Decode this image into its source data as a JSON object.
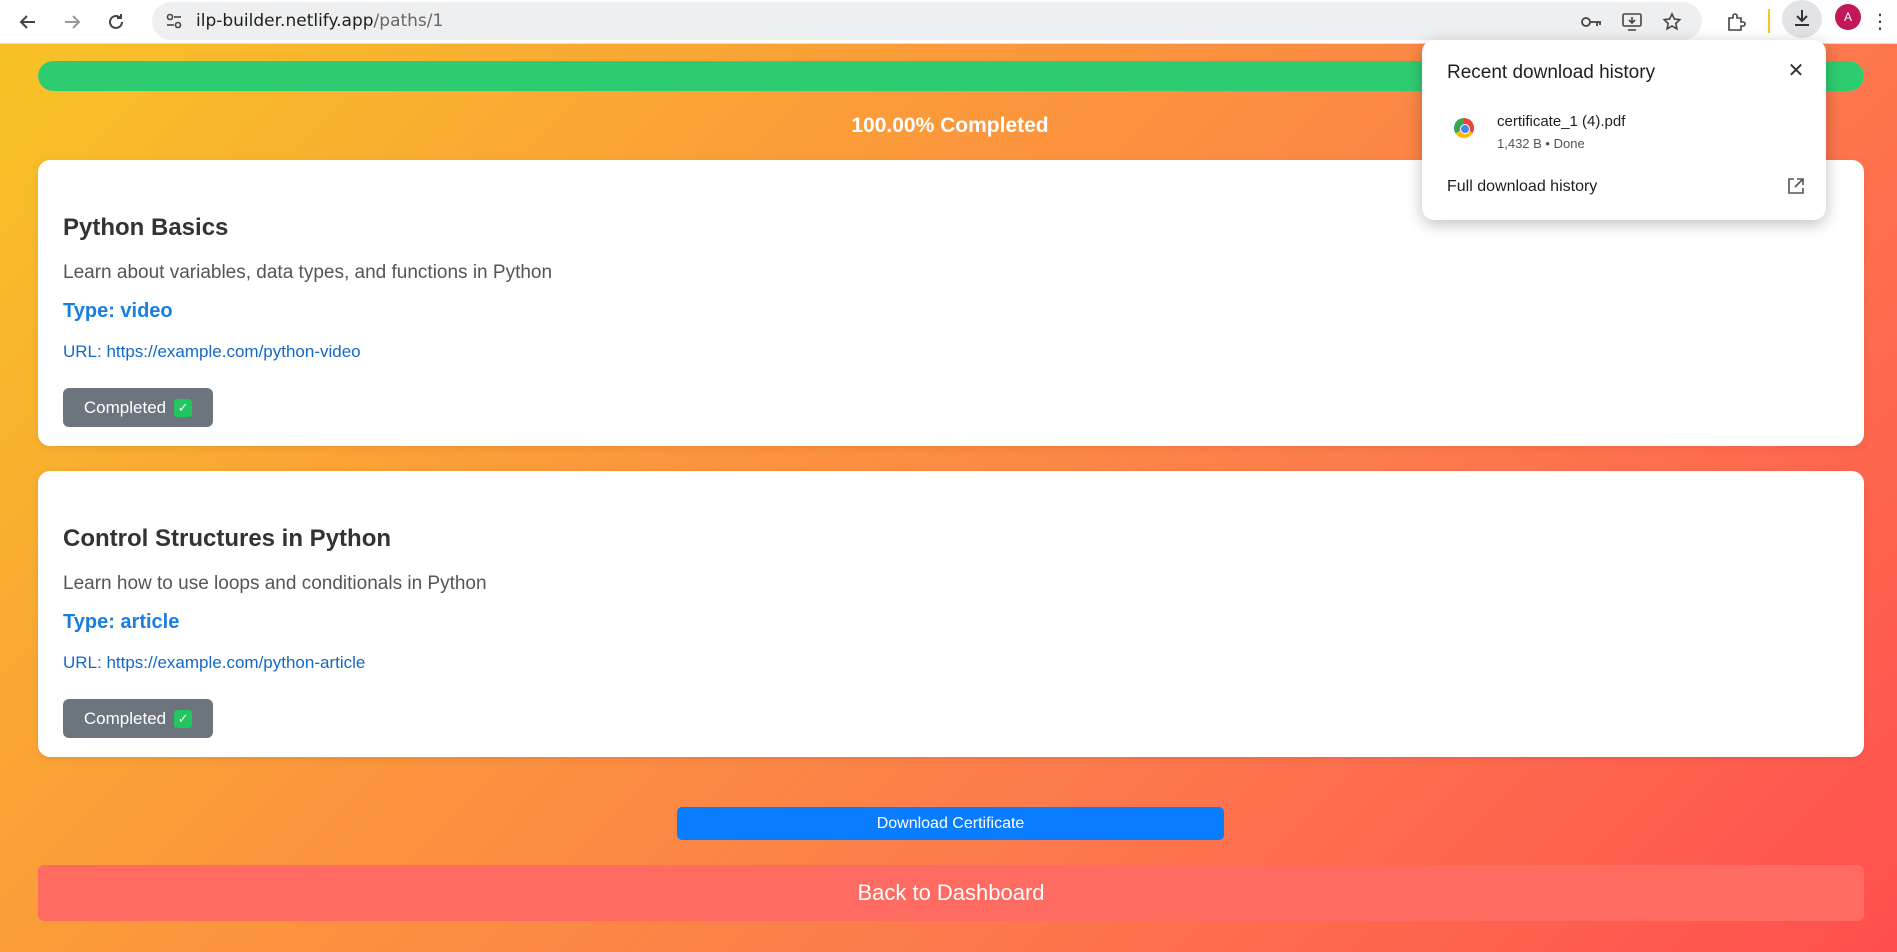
{
  "browser": {
    "url_host": "ilp-builder.netlify.app",
    "url_path": "/paths/1",
    "avatar_letter": "A",
    "icons": [
      "back-icon",
      "forward-icon",
      "reload-icon",
      "site-info-icon",
      "password-key-icon",
      "install-app-icon",
      "bookmark-star-icon",
      "extensions-icon",
      "download-icon",
      "menu-icon"
    ]
  },
  "progress": {
    "percent": 100,
    "label": "100.00% Completed"
  },
  "modules": [
    {
      "title": "Python Basics",
      "description": "Learn about variables, data types, and functions in Python",
      "type": "Type: video",
      "url": "URL: https://example.com/python-video",
      "status": "Completed",
      "status_icon": "✓"
    },
    {
      "title": "Control Structures in Python",
      "description": "Learn how to use loops and conditionals in Python",
      "type": "Type: article",
      "url": "URL: https://example.com/python-article",
      "status": "Completed",
      "status_icon": "✓"
    }
  ],
  "actions": {
    "download_certificate": "Download Certificate",
    "back_to_dashboard": "Back to Dashboard"
  },
  "download_popup": {
    "title": "Recent download history",
    "item_name": "certificate_1 (4).pdf",
    "item_meta": "1,432 B • Done",
    "full_history": "Full download history"
  },
  "colors": {
    "progress_fill": "#2ecc71",
    "download_button": "#0a7cff",
    "back_button": "#ff6b61",
    "type_text": "#1a7de0",
    "status_button": "#6c757d"
  }
}
